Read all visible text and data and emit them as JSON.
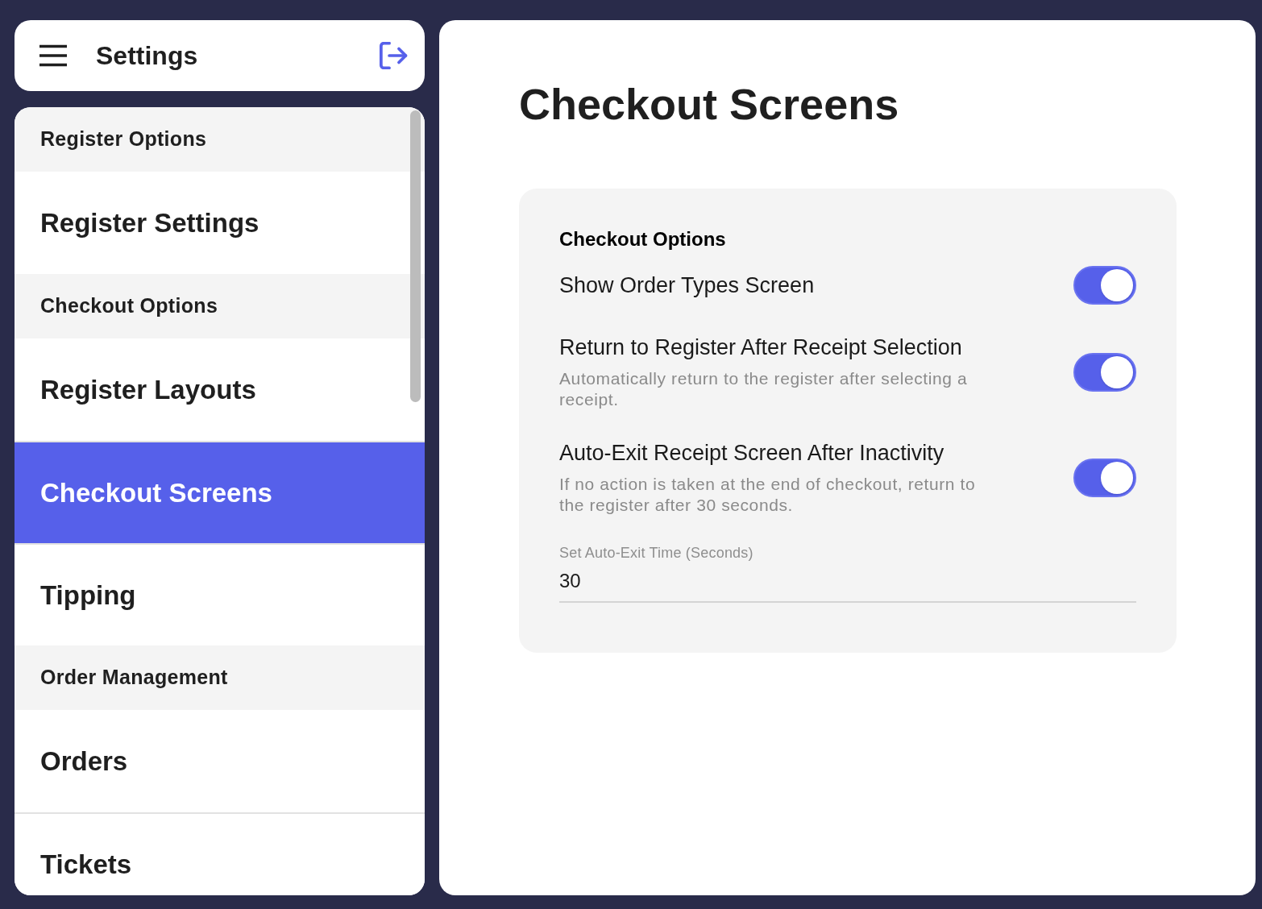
{
  "header": {
    "title": "Settings"
  },
  "sidebar": {
    "items": [
      {
        "kind": "section",
        "label": "Register Options"
      },
      {
        "kind": "item",
        "label": "Register Settings",
        "selected": false
      },
      {
        "kind": "section",
        "label": "Checkout Options"
      },
      {
        "kind": "item",
        "label": "Register Layouts",
        "selected": false
      },
      {
        "kind": "item",
        "label": "Checkout Screens",
        "selected": true
      },
      {
        "kind": "item",
        "label": "Tipping",
        "selected": false
      },
      {
        "kind": "section",
        "label": "Order Management"
      },
      {
        "kind": "item",
        "label": "Orders",
        "selected": false
      },
      {
        "kind": "item",
        "label": "Tickets",
        "selected": false
      }
    ]
  },
  "page": {
    "title": "Checkout Screens"
  },
  "card": {
    "heading": "Checkout Options",
    "options": [
      {
        "label": "Show Order Types Screen",
        "on": true
      },
      {
        "label": "Return to Register After Receipt Selection",
        "description": "Automatically return to the register after selecting a receipt.",
        "on": true
      },
      {
        "label": "Auto-Exit Receipt Screen After Inactivity",
        "description": "If no action is taken at the end of checkout, return to the register after 30 seconds.",
        "on": true
      }
    ],
    "field": {
      "label": "Set Auto-Exit Time (Seconds)",
      "value": "30"
    }
  }
}
